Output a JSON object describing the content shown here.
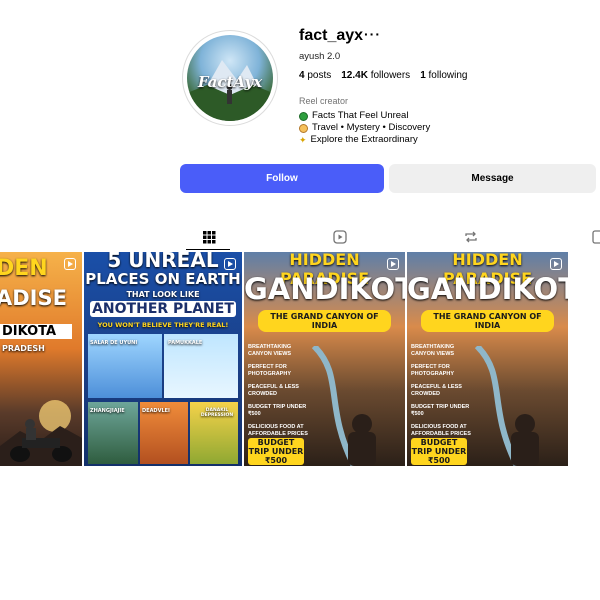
{
  "profile": {
    "username": "fact_ayx",
    "more_icon": "ellipsis-icon",
    "display_name": "ayush 2.0",
    "avatar_text": "FactAyx",
    "stats": {
      "posts_count": "4",
      "posts_label": "posts",
      "followers_count": "12.4K",
      "followers_label": "followers",
      "following_count": "1",
      "following_label": "following"
    },
    "category": "Reel creator",
    "bio": [
      {
        "icon": "green-circle",
        "text": "Facts That Feel Unreal"
      },
      {
        "icon": "compass",
        "text": "Travel • Mystery • Discovery"
      },
      {
        "icon": "sparkle",
        "text": "Explore the Extraordinary"
      }
    ]
  },
  "actions": {
    "follow_label": "Follow",
    "message_label": "Message"
  },
  "tabs": [
    "grid-icon",
    "reels-icon",
    "reposts-icon",
    "tagged-icon"
  ],
  "posts": [
    {
      "line1": "DEN",
      "line2": "ADISE",
      "line3": "DIKOTA",
      "line4": "PRADESH"
    },
    {
      "line1": "5 UNREAL",
      "line2": "PLACES ON EARTH",
      "line3": "THAT LOOK LIKE",
      "line4": "ANOTHER PLANET",
      "line5": "YOU WON'T BELIEVE THEY'RE REAL!",
      "items": [
        "SALAR DE UYUNI",
        "PAMUKKALE",
        "ZHANGJIAJIE",
        "DEADVLEI",
        "DANAKIL DEPRESSION"
      ]
    },
    {
      "line1": "HIDDEN PARADISE",
      "line2": "GANDIKOTA",
      "line3": "THE GRAND CANYON OF INDIA",
      "features": [
        "BREATHTAKING CANYON VIEWS",
        "PERFECT FOR PHOTOGRAPHY",
        "PEACEFUL & LESS CROWDED",
        "BUDGET TRIP UNDER ₹500",
        "DELICIOUS FOOD AT AFFORDABLE PRICES"
      ],
      "budget": "BUDGET TRIP UNDER ₹500"
    },
    {
      "line1": "HIDDEN PARADISE",
      "line2": "GANDIKOTA",
      "line3": "THE GRAND CANYON OF INDIA",
      "features": [
        "BREATHTAKING CANYON VIEWS",
        "PERFECT FOR PHOTOGRAPHY",
        "PEACEFUL & LESS CROWDED",
        "BUDGET TRIP UNDER ₹500",
        "DELICIOUS FOOD AT AFFORDABLE PRICES"
      ],
      "budget": "BUDGET TRIP UNDER ₹500"
    }
  ],
  "colors": {
    "follow": "#4a5df9",
    "message": "#efefef"
  }
}
